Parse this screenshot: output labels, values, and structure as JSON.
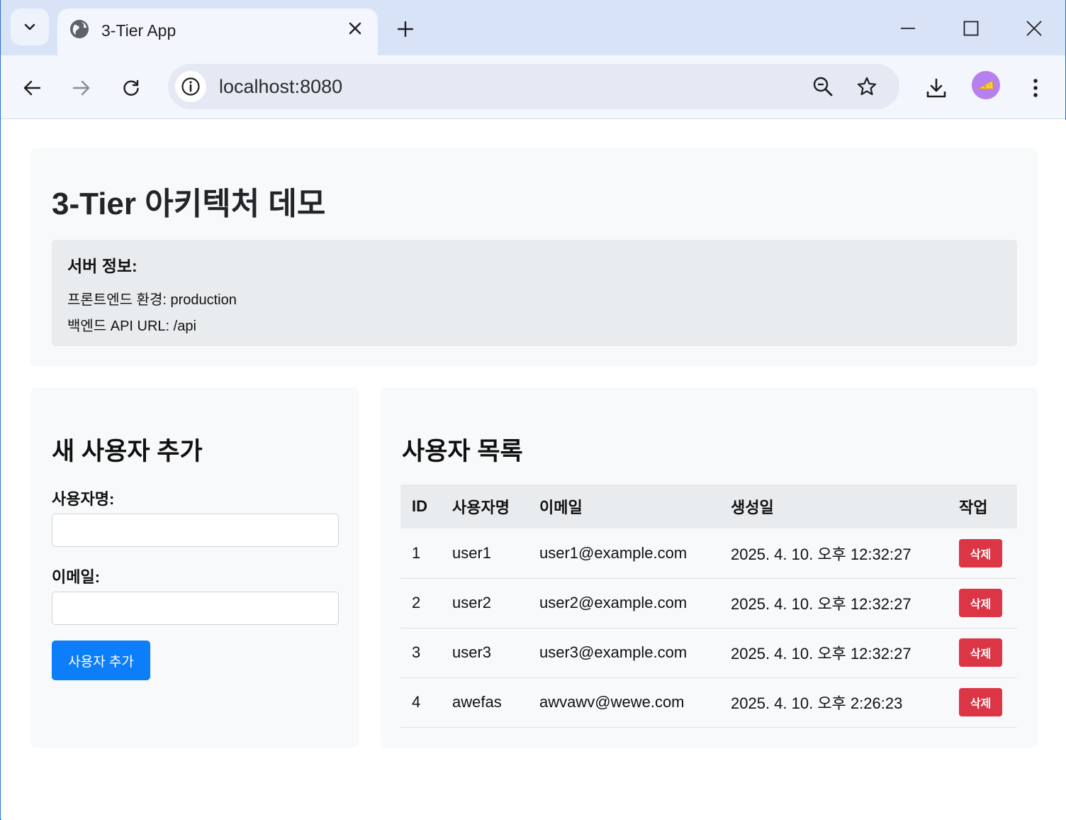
{
  "browser": {
    "tab_title": "3-Tier App",
    "url": "localhost:8080"
  },
  "page": {
    "title": "3-Tier 아키텍처 데모",
    "server_info": {
      "heading": "서버 정보:",
      "frontend_env": "프론트엔드 환경: production",
      "backend_url": "백엔드 API URL: /api"
    }
  },
  "form": {
    "title": "새 사용자 추가",
    "username_label": "사용자명:",
    "username_value": "",
    "email_label": "이메일:",
    "email_value": "",
    "submit_label": "사용자 추가"
  },
  "users": {
    "title": "사용자 목록",
    "columns": [
      "ID",
      "사용자명",
      "이메일",
      "생성일",
      "작업"
    ],
    "rows": [
      {
        "id": "1",
        "username": "user1",
        "email": "user1@example.com",
        "created": "2025. 4. 10. 오후 12:32:27",
        "action": "삭제"
      },
      {
        "id": "2",
        "username": "user2",
        "email": "user2@example.com",
        "created": "2025. 4. 10. 오후 12:32:27",
        "action": "삭제"
      },
      {
        "id": "3",
        "username": "user3",
        "email": "user3@example.com",
        "created": "2025. 4. 10. 오후 12:32:27",
        "action": "삭제"
      },
      {
        "id": "4",
        "username": "awefas",
        "email": "awvawv@wewe.com",
        "created": "2025. 4. 10. 오후 2:26:23",
        "action": "삭제"
      }
    ]
  },
  "colors": {
    "primary": "#0d7ef9",
    "danger": "#dc3545",
    "card_bg": "#f8f9fa",
    "info_bg": "#e9ecef"
  }
}
